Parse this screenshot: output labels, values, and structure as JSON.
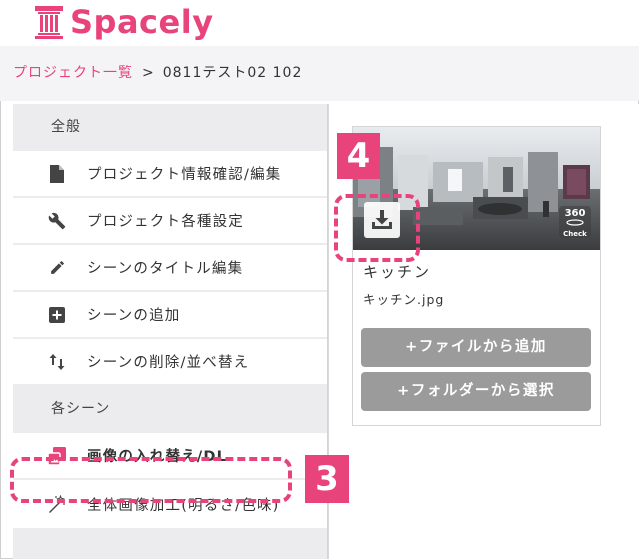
{
  "header": {
    "logo_text": "Spacely",
    "logo_icon": "pillar-icon",
    "brand_color": "#e8437b"
  },
  "breadcrumb": {
    "link": "プロジェクト一覧",
    "separator": ">",
    "current": "0811テスト02 102"
  },
  "sidebar": {
    "section_general": "全般",
    "general_items": [
      {
        "label": "プロジェクト情報確認/編集",
        "icon": "document-icon"
      },
      {
        "label": "プロジェクト各種設定",
        "icon": "wrench-icon"
      },
      {
        "label": "シーンのタイトル編集",
        "icon": "pencil-icon"
      },
      {
        "label": "シーンの追加",
        "icon": "plus-square-icon"
      },
      {
        "label": "シーンの削除/並べ替え",
        "icon": "sort-arrows-icon"
      }
    ],
    "section_scene": "各シーン",
    "scene_items": [
      {
        "label": "画像の入れ替え/DL",
        "icon": "swap-images-icon",
        "active": true
      },
      {
        "label": "全体画像加工(明るさ/色味)",
        "icon": "magic-wand-icon",
        "active": false
      }
    ]
  },
  "scene_card": {
    "title": "キッチン",
    "filename": "キッチン.jpg",
    "download_icon": "download-icon",
    "badge_line1": "360",
    "badge_line2": "Check",
    "add_file_button": "+ファイルから追加",
    "add_folder_button": "+フォルダーから選択"
  },
  "annotations": {
    "step4": "4",
    "step3": "3",
    "color": "#e8437b"
  }
}
